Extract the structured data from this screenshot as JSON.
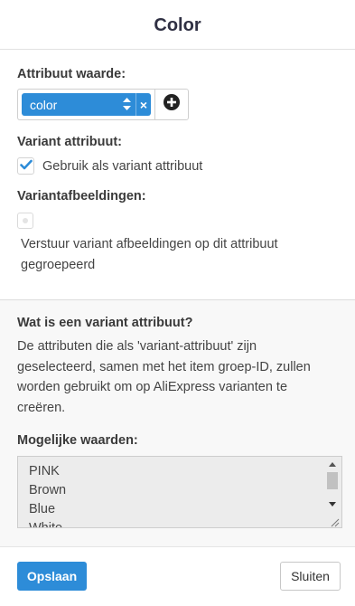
{
  "modal": {
    "title": "Color"
  },
  "attribute_value": {
    "label": "Attribuut waarde:",
    "selected": "color",
    "remove_symbol": "×"
  },
  "variant_attribute": {
    "label": "Variant attribuut:",
    "checkbox_label": "Gebruik als variant attribuut",
    "checked": true
  },
  "variant_images": {
    "label": "Variantafbeeldingen:",
    "option_text": "Verstuur variant afbeeldingen op dit attribuut gegroepeerd",
    "checked": false
  },
  "info": {
    "title": "Wat is een variant attribuut?",
    "text": "De attributen die als 'variant-attribuut' zijn geselecteerd, samen met het item groep-ID, zullen worden gebruikt om op AliExpress varianten te creëren."
  },
  "possible_values": {
    "label": "Mogelijke waarden:",
    "items": [
      "PINK",
      "Brown",
      "Blue",
      "White"
    ]
  },
  "footer": {
    "save_label": "Opslaan",
    "close_label": "Sluiten"
  },
  "colors": {
    "accent": "#2d8cd8",
    "title_text": "#2f3043",
    "info_bg": "#f8f8f8"
  },
  "icons": {
    "add": "plus-circle-icon",
    "check": "checkmark-icon",
    "sort": "sort-arrows-icon"
  }
}
